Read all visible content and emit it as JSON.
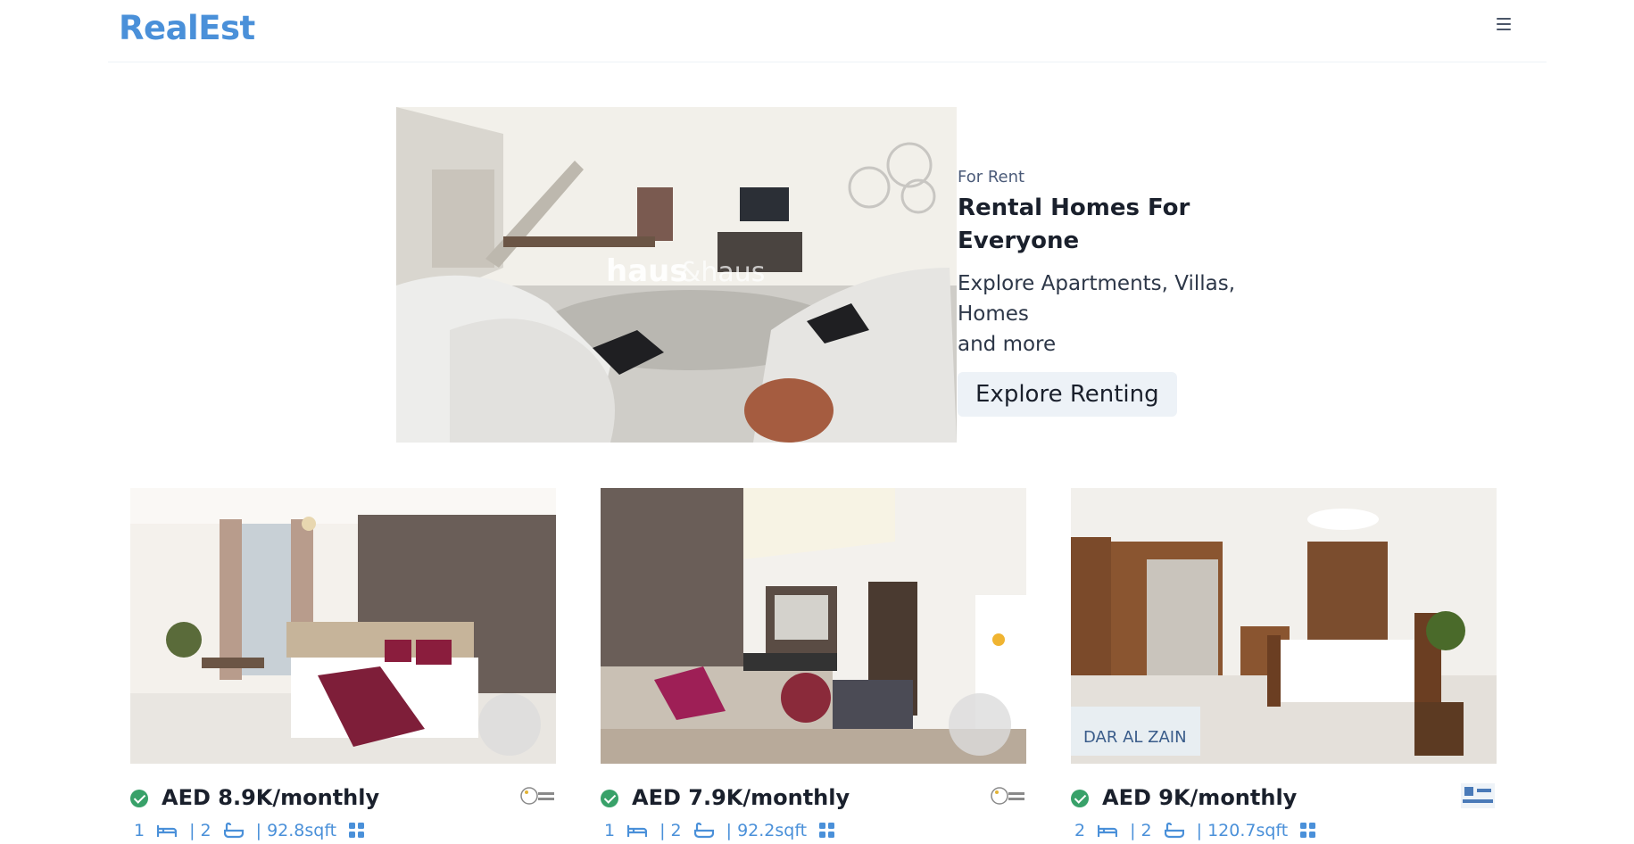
{
  "header": {
    "logo": "RealEst",
    "menu_icon": "hamburger-menu-icon"
  },
  "banner": {
    "purpose": "For Rent",
    "title_line1": "Rental Homes For",
    "title_line2": "Everyone",
    "desc_line1": "Explore Apartments, Villas, Homes",
    "desc_line2": "and more",
    "button_label": "Explore Renting",
    "image_watermark": "haus & haus"
  },
  "properties": [
    {
      "price": "AED 8.9K/monthly",
      "rooms": "1",
      "baths": "| 2",
      "area": "| 92.8sqft",
      "agency_logo": "holiday-boulevard-logo",
      "verified": true
    },
    {
      "price": "AED 7.9K/monthly",
      "rooms": "1",
      "baths": "| 2",
      "area": "| 92.2sqft",
      "agency_logo": "holiday-boulevard-logo",
      "verified": true
    },
    {
      "price": "AED 9K/monthly",
      "rooms": "2",
      "baths": "| 2",
      "area": "| 120.7sqft",
      "agency_logo": "dar-al-zain-logo",
      "verified": true
    }
  ],
  "colors": {
    "brand": "#4a90d9",
    "verified": "#38a169",
    "button_bg": "#edf2f7",
    "text": "#1a202c"
  }
}
